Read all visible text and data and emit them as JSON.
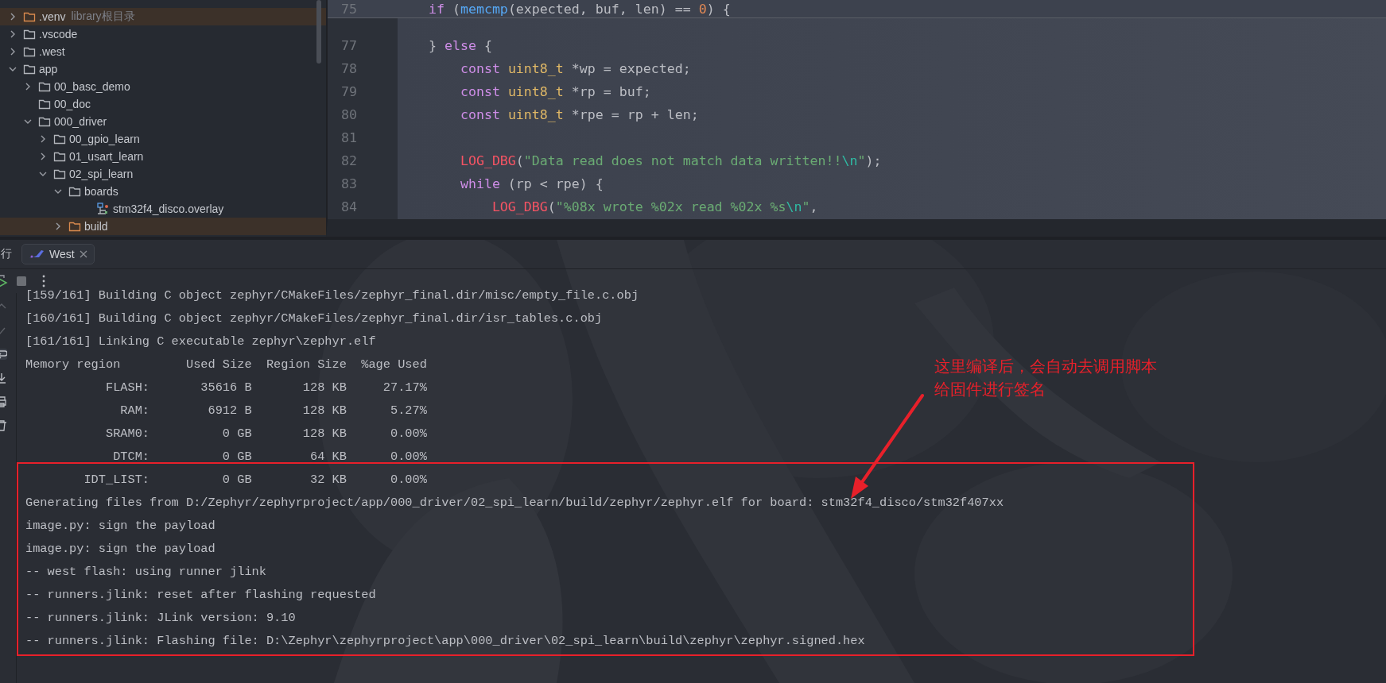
{
  "project_tree": {
    "items": [
      {
        "name": ".venv",
        "hint": "library根目录",
        "kind": "folder",
        "expanded": false,
        "excluded": true
      },
      {
        "name": ".vscode",
        "kind": "folder",
        "expanded": false,
        "excluded": false
      },
      {
        "name": ".west",
        "kind": "folder",
        "expanded": false,
        "excluded": false
      },
      {
        "name": "app",
        "kind": "folder",
        "expanded": true,
        "excluded": false,
        "children": [
          {
            "name": "00_basc_demo",
            "kind": "folder",
            "expanded": false,
            "excluded": false
          },
          {
            "name": "00_doc",
            "kind": "empty-folder",
            "excluded": false
          },
          {
            "name": "000_driver",
            "kind": "folder",
            "expanded": true,
            "excluded": false,
            "children": [
              {
                "name": "00_gpio_learn",
                "kind": "folder",
                "expanded": false,
                "excluded": false
              },
              {
                "name": "01_usart_learn",
                "kind": "folder",
                "expanded": false,
                "excluded": false
              },
              {
                "name": "02_spi_learn",
                "kind": "folder",
                "expanded": true,
                "excluded": false,
                "children": [
                  {
                    "name": "boards",
                    "kind": "folder",
                    "expanded": true,
                    "excluded": false,
                    "children": [
                      {
                        "name": "stm32f4_disco.overlay",
                        "kind": "overlay-file",
                        "excluded": false
                      }
                    ]
                  },
                  {
                    "name": "build",
                    "kind": "folder",
                    "expanded": false,
                    "excluded": true
                  }
                ]
              }
            ]
          }
        ]
      }
    ]
  },
  "editor": {
    "sticky_line": {
      "number": "75",
      "tokens": [
        {
          "kind": "kw",
          "s": "if"
        },
        {
          "kind": "plain",
          "s": " ("
        },
        {
          "kind": "fn",
          "s": "memcmp"
        },
        {
          "kind": "plain",
          "s": "(expected, buf, len) == "
        },
        {
          "kind": "num",
          "s": "0"
        },
        {
          "kind": "plain",
          "s": ") {"
        }
      ]
    },
    "lines": [
      {
        "number": "77",
        "tokens": [
          {
            "kind": "plain",
            "s": "} "
          },
          {
            "kind": "kw",
            "s": "else"
          },
          {
            "kind": "plain",
            "s": " {"
          }
        ],
        "children": [
          {
            "number": "78",
            "tokens": [
              {
                "kind": "kw",
                "s": "const "
              },
              {
                "kind": "type",
                "s": "uint8_t"
              },
              {
                "kind": "plain",
                "s": " *wp = expected;"
              }
            ]
          },
          {
            "number": "79",
            "tokens": [
              {
                "kind": "kw",
                "s": "const "
              },
              {
                "kind": "type",
                "s": "uint8_t"
              },
              {
                "kind": "plain",
                "s": " *rp = buf;"
              }
            ]
          },
          {
            "number": "80",
            "tokens": [
              {
                "kind": "kw",
                "s": "const "
              },
              {
                "kind": "type",
                "s": "uint8_t"
              },
              {
                "kind": "plain",
                "s": " *rpe = rp + len;"
              }
            ]
          },
          {
            "number": "81"
          },
          {
            "number": "82",
            "tokens": [
              {
                "kind": "macro",
                "s": "LOG_DBG"
              },
              {
                "kind": "plain",
                "s": "("
              },
              {
                "kind": "str",
                "s": "\"Data read does not match data written!!"
              },
              {
                "kind": "esc",
                "s": "\\n"
              },
              {
                "kind": "str",
                "s": "\""
              },
              {
                "kind": "plain",
                "s": ");"
              }
            ]
          },
          {
            "number": "83",
            "tokens": [
              {
                "kind": "kw",
                "s": "while"
              },
              {
                "kind": "plain",
                "s": " (rp < rpe) {"
              }
            ],
            "children": [
              {
                "number": "84",
                "tokens": [
                  {
                    "kind": "macro",
                    "s": "LOG_DBG"
                  },
                  {
                    "kind": "plain",
                    "s": "("
                  },
                  {
                    "kind": "str",
                    "s": "\"%08x wrote %02x read %02x %s"
                  },
                  {
                    "kind": "esc",
                    "s": "\\n"
                  },
                  {
                    "kind": "str",
                    "s": "\""
                  },
                  {
                    "kind": "plain",
                    "s": ","
                  }
                ]
              }
            ]
          }
        ]
      }
    ]
  },
  "run_panel": {
    "title": "行",
    "tabs": [
      {
        "label": "West",
        "selected": true
      }
    ],
    "output": {
      "lines_before": [
        "[159/161] Building C object zephyr/CMakeFiles/zephyr_final.dir/misc/empty_file.c.obj",
        "[160/161] Building C object zephyr/CMakeFiles/zephyr_final.dir/isr_tables.c.obj",
        "[161/161] Linking C executable zephyr\\zephyr.elf",
        "Memory region         Used Size  Region Size  %age Used",
        "           FLASH:       35616 B       128 KB     27.17%",
        "             RAM:        6912 B       128 KB      5.27%",
        "           SRAM0:          0 GB       128 KB      0.00%",
        "            DTCM:          0 GB        64 KB      0.00%"
      ],
      "boxed_lines": [
        "        IDT_LIST:          0 GB        32 KB      0.00%",
        "Generating files from D:/Zephyr/zephyrproject/app/000_driver/02_spi_learn/build/zephyr/zephyr.elf for board: stm32f4_disco/stm32f407xx",
        "image.py: sign the payload",
        "image.py: sign the payload",
        "-- west flash: using runner jlink",
        "-- runners.jlink: reset after flashing requested",
        "-- runners.jlink: JLink version: 9.10",
        "-- runners.jlink: Flashing file: D:\\Zephyr\\zephyrproject\\app\\000_driver\\02_spi_learn\\build\\zephyr\\zephyr.signed.hex"
      ]
    },
    "annotation": {
      "lines": [
        "这里编译后，会自动去调用脚本",
        "给固件进行签名"
      ]
    }
  }
}
